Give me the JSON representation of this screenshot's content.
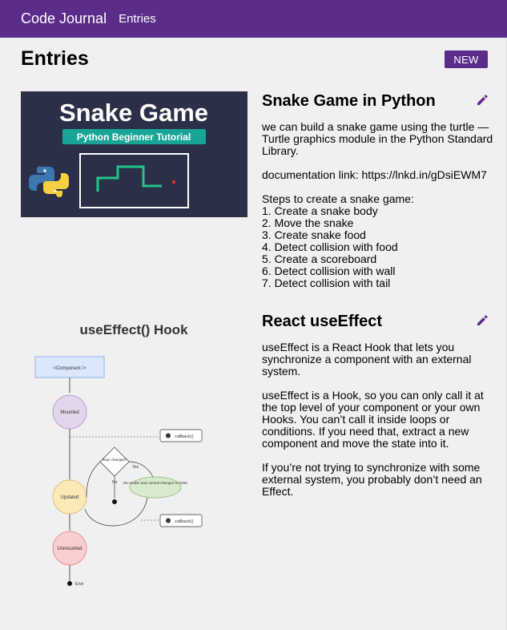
{
  "nav": {
    "brand": "Code Journal",
    "link": "Entries"
  },
  "page": {
    "title": "Entries",
    "new_label": "NEW"
  },
  "entries": [
    {
      "title": "Snake Game in Python",
      "image": {
        "headline": "Snake Game",
        "subtitle": "Python Beginner Tutorial"
      },
      "paragraphs": [
        "we can build a snake game using the turtle — Turtle graphics module in the Python Standard Library.",
        "documentation link: https://lnkd.in/gDsiEWM7"
      ],
      "steps_heading": "Steps to create a snake game:",
      "steps": [
        "1. Create a snake body",
        "2. Move the snake",
        "3. Create snake food",
        "4. Detect collision with food",
        "5. Create a scoreboard",
        "6. Detect collision with wall",
        "7. Detect collision with tail"
      ],
      "edit_icon": "pencil-icon"
    },
    {
      "title": "React useEffect",
      "image": {
        "headline": "useEffect() Hook",
        "component": "<Component />",
        "mounted": "Mounted",
        "updated": "Updated",
        "unmounted": "Unmounted",
        "callback": "callback()",
        "deps": "deps changed?",
        "yes": "Yes",
        "no": "No",
        "rerender": "Re-render and commit changes to DOM",
        "end": "End"
      },
      "paragraphs": [
        "useEffect is a React Hook that lets you synchronize a component with an external system.",
        "useEffect is a Hook, so you can only call it at the top level of your component or your own Hooks. You can’t call it inside loops or conditions. If you need that, extract a new component and move the state into it.",
        "If you’re not trying to synchronize with some external system, you probably don’t need an Effect."
      ],
      "edit_icon": "pencil-icon"
    }
  ],
  "colors": {
    "navbar": "#5b2c8a",
    "button": "#5b2c8a",
    "pencil": "#5b2c8a",
    "snake_bg": "#2b3048",
    "snake_badge": "#18a596",
    "snake_line": "#22c48a"
  }
}
